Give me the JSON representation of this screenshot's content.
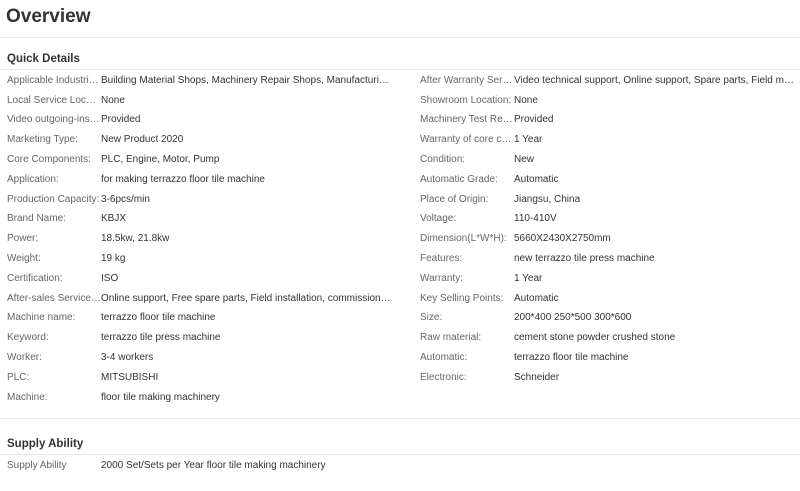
{
  "overview": {
    "title": "Overview"
  },
  "quick_details": {
    "title": "Quick Details",
    "left": [
      {
        "label": "Applicable Industries:",
        "value": "Building Material Shops, Machinery Repair Shops, Manufacturing Plant"
      },
      {
        "label": "Local Service Location:",
        "value": "None"
      },
      {
        "label": "Video outgoing-inspection:",
        "value": "Provided"
      },
      {
        "label": "Marketing Type:",
        "value": "New Product 2020"
      },
      {
        "label": "Core Components:",
        "value": "PLC, Engine, Motor, Pump"
      },
      {
        "label": "Application:",
        "value": "for making terrazzo floor tile machine"
      },
      {
        "label": "Production Capacity:",
        "value": "3-6pcs/min"
      },
      {
        "label": "Brand Name:",
        "value": "KBJX"
      },
      {
        "label": "Power:",
        "value": "18.5kw, 21.8kw"
      },
      {
        "label": "Weight:",
        "value": "19 kg"
      },
      {
        "label": "Certification:",
        "value": "ISO"
      },
      {
        "label": "After-sales Service Provided:",
        "value": "Online support, Free spare parts, Field installation, commissioning and training"
      },
      {
        "label": "Machine name:",
        "value": "terrazzo floor tile machine"
      },
      {
        "label": "Keyword:",
        "value": "terrazzo tile press machine"
      },
      {
        "label": "Worker:",
        "value": "3-4 workers"
      },
      {
        "label": "PLC:",
        "value": "MITSUBISHI"
      },
      {
        "label": "Machine:",
        "value": "floor tile making machinery"
      }
    ],
    "right": [
      {
        "label": "After Warranty Service:",
        "value": "Video technical support, Online support, Spare parts, Field maintenance"
      },
      {
        "label": "Showroom Location:",
        "value": "None"
      },
      {
        "label": "Machinery Test Report:",
        "value": "Provided"
      },
      {
        "label": "Warranty of core components:",
        "value": "1 Year"
      },
      {
        "label": "Condition:",
        "value": "New"
      },
      {
        "label": "Automatic Grade:",
        "value": "Automatic"
      },
      {
        "label": "Place of Origin:",
        "value": "Jiangsu, China"
      },
      {
        "label": "Voltage:",
        "value": "110-410V"
      },
      {
        "label": "Dimension(L*W*H):",
        "value": "5660X2430X2750mm"
      },
      {
        "label": "Features:",
        "value": "new terrazzo tile press machine"
      },
      {
        "label": "Warranty:",
        "value": "1 Year"
      },
      {
        "label": "Key Selling Points:",
        "value": "Automatic"
      },
      {
        "label": "Size:",
        "value": "200*400 250*500 300*600"
      },
      {
        "label": "Raw material:",
        "value": "cement stone powder crushed stone"
      },
      {
        "label": "Automatic:",
        "value": "terrazzo floor tile machine"
      },
      {
        "label": "Electronic:",
        "value": "Schneider"
      }
    ]
  },
  "supply_ability": {
    "title": "Supply Ability",
    "rows": [
      {
        "label": "Supply Ability",
        "value": "2000 Set/Sets per Year floor tile making machinery"
      }
    ]
  }
}
